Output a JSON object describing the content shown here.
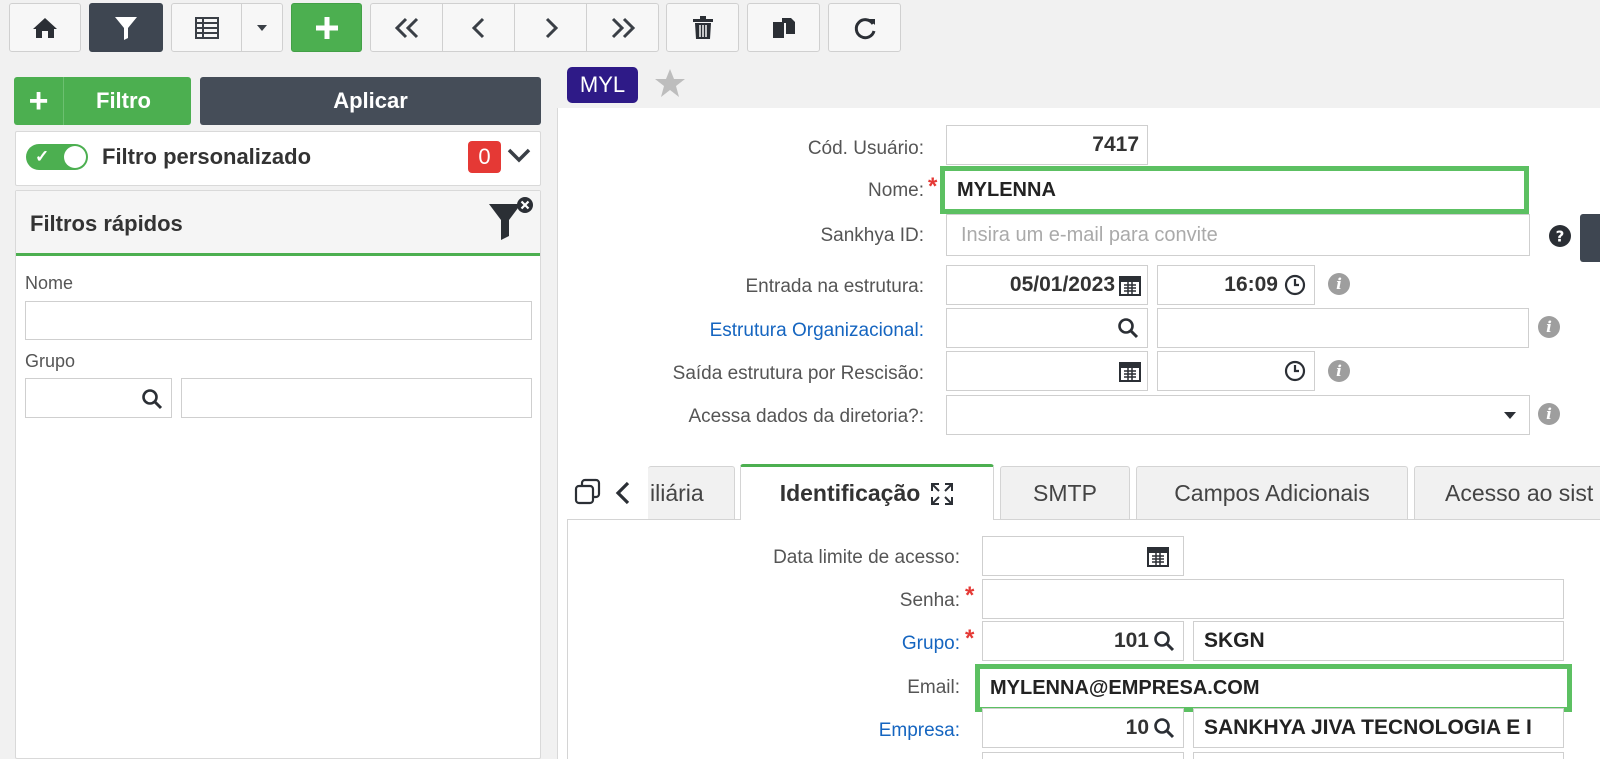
{
  "toolbar": {
    "home": "home-icon",
    "filter": "filter-icon",
    "grid": "grid-icon",
    "add": "plus-icon",
    "first": "first-icon",
    "prev": "prev-icon",
    "next": "next-icon",
    "last": "last-icon",
    "delete": "trash-icon",
    "copy": "copy-icon",
    "refresh": "refresh-icon"
  },
  "left": {
    "filtro_label": "Filtro",
    "aplicar_label": "Aplicar",
    "custom_filter_label": "Filtro personalizado",
    "custom_filter_count": "0",
    "quick_filters_title": "Filtros rápidos",
    "nome_label": "Nome",
    "grupo_label": "Grupo"
  },
  "record": {
    "tag": "MYL",
    "fields": {
      "cod_usuario_label": "Cód. Usuário:",
      "cod_usuario_value": "7417",
      "nome_label": "Nome:",
      "nome_value": "MYLENNA",
      "sankhya_id_label": "Sankhya ID:",
      "sankhya_id_placeholder": "Insira um e-mail para convite",
      "entrada_label": "Entrada na estrutura:",
      "entrada_date": "05/01/2023",
      "entrada_time": "16:09",
      "estrutura_label": "Estrutura Organizacional:",
      "saida_label": "Saída estrutura por Rescisão:",
      "acessa_label": "Acessa dados da diretoria?:"
    }
  },
  "tabs": {
    "t1": "iliária",
    "t2": "Identificação",
    "t3": "SMTP",
    "t4": "Campos Adicionais",
    "t5": "Acesso ao sist"
  },
  "ident": {
    "data_limite_label": "Data limite de acesso:",
    "senha_label": "Senha:",
    "grupo_label": "Grupo:",
    "grupo_code": "101",
    "grupo_name": "SKGN",
    "email_label": "Email:",
    "email_value": "MYLENNA@EMPRESA.COM",
    "empresa_label": "Empresa:",
    "empresa_code": "10",
    "empresa_name": "SANKHYA JIVA TECNOLOGIA E I"
  }
}
